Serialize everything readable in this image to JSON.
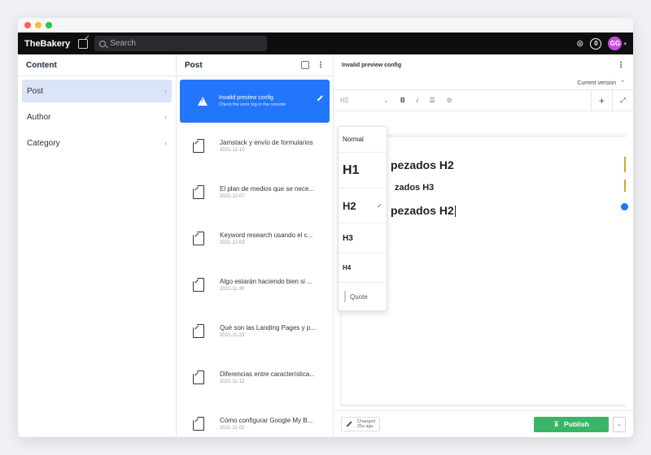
{
  "window": {
    "dots": [
      "#ff5f57",
      "#febc2e",
      "#28c840"
    ]
  },
  "navbar": {
    "brand": "TheBakery",
    "search_placeholder": "Search",
    "badge_count": "0",
    "avatar_initials": "GG"
  },
  "content_pane": {
    "title": "Content",
    "items": [
      {
        "label": "Post",
        "active": true
      },
      {
        "label": "Author"
      },
      {
        "label": "Category"
      }
    ]
  },
  "post_pane": {
    "title": "Post",
    "active_doc": {
      "title": "Invalid preview config",
      "subtitle": "Check the error log in the console"
    },
    "docs": [
      {
        "title": "Jamstack y envío de formularios",
        "date": "2021-12-10"
      },
      {
        "title": "El plan de medios que se nece...",
        "date": "2021-12-07"
      },
      {
        "title": "Keyword research usando el c...",
        "date": "2021-12-03"
      },
      {
        "title": "Algo estarán haciendo bien si ...",
        "date": "2021-11-30"
      },
      {
        "title": "Qué son las Landing Pages y p...",
        "date": "2021-11-23"
      },
      {
        "title": "Diferencias entre característica...",
        "date": "2021-11-12"
      },
      {
        "title": "Cómo configurar Google My B...",
        "date": "2021-11-02"
      }
    ]
  },
  "editor": {
    "title": "Invalid preview config",
    "version_label": "Current version",
    "toolbar": {
      "style_value": "H2",
      "bold": "B",
      "italic": "i",
      "list": "☰",
      "link": "⊘",
      "add": "+",
      "expand": "⤢"
    },
    "content": {
      "line1": "pezados H2",
      "line2": "zados H3",
      "line3": "pezados H2"
    },
    "style_menu": {
      "options": [
        "Normal",
        "H1",
        "H2",
        "H3",
        "H4",
        "Quote"
      ],
      "selected": "H2"
    },
    "footer": {
      "changed_label": "Changed",
      "changed_time": "25s ago",
      "publish_label": "Publish"
    }
  },
  "icons": {
    "compose": "compose-icon",
    "search": "search-icon",
    "plugin": "plugin-icon",
    "warning": "warning-icon",
    "document": "document-icon",
    "checkmark": "checkmark-icon"
  },
  "colors": {
    "accent": "#2276fc",
    "publish": "#3ab466",
    "avatar": "#c84bdc",
    "marker": "#d4a23a"
  }
}
